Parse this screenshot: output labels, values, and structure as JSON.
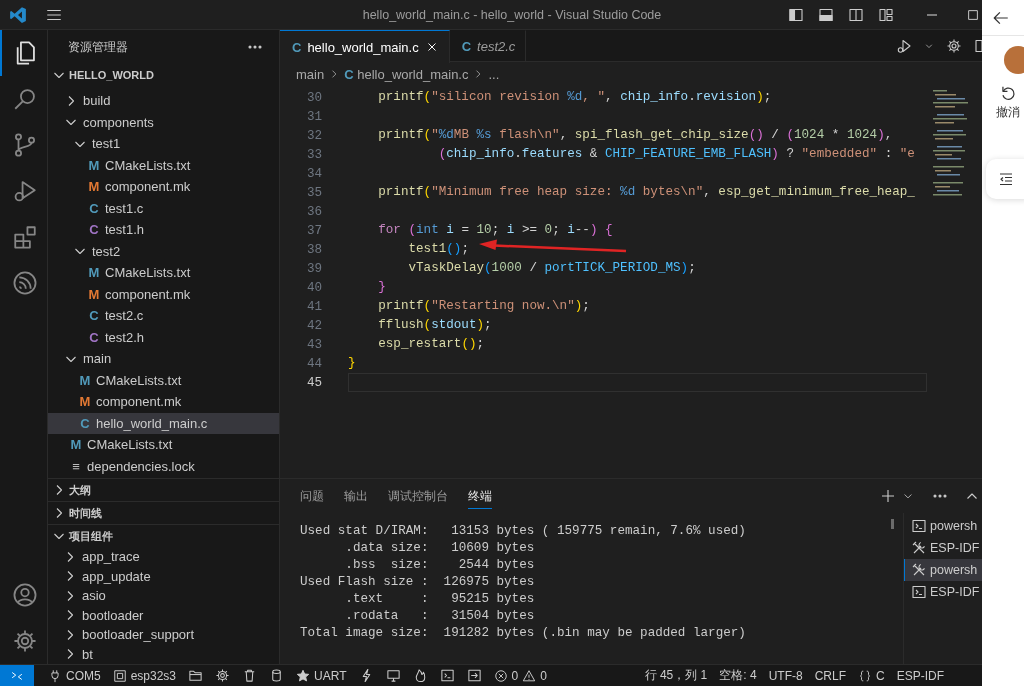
{
  "window": {
    "title": "hello_world_main.c - hello_world - Visual Studio Code"
  },
  "activity_bar": [
    {
      "selected": true
    },
    {
      "selected": false
    },
    {
      "selected": false
    },
    {
      "selected": false
    },
    {
      "selected": false
    },
    {
      "selected": false
    }
  ],
  "sidebar": {
    "title": "资源管理器",
    "workspace": {
      "name": "HELLO_WORLD",
      "expanded": true,
      "tree": [
        {
          "name": "build",
          "kind": "folder",
          "expanded": false,
          "selected": false
        },
        {
          "name": "components",
          "kind": "folder",
          "expanded": true,
          "selected": false,
          "children": [
            {
              "name": "test1",
              "kind": "folder",
              "expanded": true,
              "selected": false,
              "children": [
                {
                  "name": "CMakeLists.txt",
                  "kind": "cmake",
                  "badge": "M",
                  "selected": false
                },
                {
                  "name": "component.mk",
                  "kind": "make",
                  "badge": "M",
                  "selected": false
                },
                {
                  "name": "test1.c",
                  "kind": "c",
                  "badge": "C",
                  "selected": false
                },
                {
                  "name": "test1.h",
                  "kind": "h",
                  "badge": "C",
                  "selected": false
                }
              ]
            },
            {
              "name": "test2",
              "kind": "folder",
              "expanded": true,
              "selected": false,
              "children": [
                {
                  "name": "CMakeLists.txt",
                  "kind": "cmake",
                  "badge": "M",
                  "selected": false
                },
                {
                  "name": "component.mk",
                  "kind": "make",
                  "badge": "M",
                  "selected": false
                },
                {
                  "name": "test2.c",
                  "kind": "c",
                  "badge": "C",
                  "selected": false
                },
                {
                  "name": "test2.h",
                  "kind": "h",
                  "badge": "C",
                  "selected": false
                }
              ]
            }
          ]
        },
        {
          "name": "main",
          "kind": "folder",
          "expanded": true,
          "selected": false,
          "children": [
            {
              "name": "CMakeLists.txt",
              "kind": "cmake",
              "badge": "M",
              "selected": false
            },
            {
              "name": "component.mk",
              "kind": "make",
              "badge": "M",
              "selected": false
            },
            {
              "name": "hello_world_main.c",
              "kind": "c",
              "badge": "C",
              "selected": true
            }
          ]
        },
        {
          "name": "CMakeLists.txt",
          "kind": "cmake",
          "badge": "M",
          "selected": false
        },
        {
          "name": "dependencies.lock",
          "kind": "lock",
          "badge": "≡",
          "selected": false
        }
      ]
    },
    "sections": [
      {
        "title": "大纲",
        "expanded": false
      },
      {
        "title": "时间线",
        "expanded": false
      },
      {
        "title": "项目组件",
        "expanded": true,
        "items": [
          {
            "name": "app_trace",
            "expanded": false
          },
          {
            "name": "app_update",
            "expanded": false
          },
          {
            "name": "asio",
            "expanded": false
          },
          {
            "name": "bootloader",
            "expanded": false
          },
          {
            "name": "bootloader_support",
            "expanded": false
          },
          {
            "name": "bt",
            "expanded": false
          }
        ]
      }
    ]
  },
  "editor": {
    "tabs": [
      {
        "label": "hello_world_main.c",
        "badge": "C",
        "selected": true,
        "preview": false
      },
      {
        "label": "test2.c",
        "badge": "C",
        "selected": false,
        "preview": true
      }
    ],
    "breadcrumbs": [
      {
        "text": "main"
      },
      {
        "badge": "C",
        "text": "hello_world_main.c"
      },
      {
        "text": "..."
      }
    ],
    "lines": [
      {
        "number": "30",
        "current": false,
        "tokens": [
          {
            "kind": "fn",
            "text": "    printf"
          },
          {
            "kind": "b1",
            "text": "("
          },
          {
            "kind": "str",
            "text": "\"silicon revision "
          },
          {
            "kind": "fmt",
            "text": "%d"
          },
          {
            "kind": "str",
            "text": ", \""
          },
          {
            "kind": "p",
            "text": ", "
          },
          {
            "kind": "var",
            "text": "chip_info"
          },
          {
            "kind": "p",
            "text": "."
          },
          {
            "kind": "var",
            "text": "revision"
          },
          {
            "kind": "b1",
            "text": ")"
          },
          {
            "kind": "p",
            "text": ";"
          }
        ]
      },
      {
        "number": "31",
        "current": false
      },
      {
        "number": "32",
        "current": false,
        "tokens": [
          {
            "kind": "fn",
            "text": "    printf"
          },
          {
            "kind": "b1",
            "text": "("
          },
          {
            "kind": "str",
            "text": "\""
          },
          {
            "kind": "fmt",
            "text": "%d"
          },
          {
            "kind": "str",
            "text": "MB "
          },
          {
            "kind": "fmt",
            "text": "%s"
          },
          {
            "kind": "str",
            "text": " flash\\n\""
          },
          {
            "kind": "p",
            "text": ", "
          },
          {
            "kind": "fn",
            "text": "spi_flash_get_chip_size"
          },
          {
            "kind": "b2",
            "text": "()"
          },
          {
            "kind": "p",
            "text": " / "
          },
          {
            "kind": "b2",
            "text": "("
          },
          {
            "kind": "num",
            "text": "1024"
          },
          {
            "kind": "p",
            "text": " * "
          },
          {
            "kind": "num",
            "text": "1024"
          },
          {
            "kind": "b2",
            "text": ")"
          },
          {
            "kind": "p",
            "text": ","
          }
        ]
      },
      {
        "number": "33",
        "current": false,
        "tokens": [
          {
            "kind": "b2",
            "text": "            ("
          },
          {
            "kind": "var",
            "text": "chip_info"
          },
          {
            "kind": "p",
            "text": "."
          },
          {
            "kind": "var",
            "text": "features"
          },
          {
            "kind": "p",
            "text": " & "
          },
          {
            "kind": "mac",
            "text": "CHIP_FEATURE_EMB_FLASH"
          },
          {
            "kind": "b2",
            "text": ")"
          },
          {
            "kind": "p",
            "text": " ? "
          },
          {
            "kind": "str",
            "text": "\"embedded\""
          },
          {
            "kind": "p",
            "text": " : "
          },
          {
            "kind": "str",
            "text": "\"e"
          }
        ]
      },
      {
        "number": "34",
        "current": false
      },
      {
        "number": "35",
        "current": false,
        "tokens": [
          {
            "kind": "fn",
            "text": "    printf"
          },
          {
            "kind": "b1",
            "text": "("
          },
          {
            "kind": "str",
            "text": "\"Minimum free heap size: "
          },
          {
            "kind": "fmt",
            "text": "%d"
          },
          {
            "kind": "str",
            "text": " bytes\\n\""
          },
          {
            "kind": "p",
            "text": ", "
          },
          {
            "kind": "fn",
            "text": "esp_get_minimum_free_heap_"
          }
        ]
      },
      {
        "number": "36",
        "current": false
      },
      {
        "number": "37",
        "current": false,
        "tokens": [
          {
            "kind": "kw",
            "text": "    for "
          },
          {
            "kind": "b2",
            "text": "("
          },
          {
            "kind": "type",
            "text": "int "
          },
          {
            "kind": "var",
            "text": "i"
          },
          {
            "kind": "p",
            "text": " = "
          },
          {
            "kind": "num",
            "text": "10"
          },
          {
            "kind": "p",
            "text": "; "
          },
          {
            "kind": "var",
            "text": "i"
          },
          {
            "kind": "p",
            "text": " >= "
          },
          {
            "kind": "num",
            "text": "0"
          },
          {
            "kind": "p",
            "text": "; "
          },
          {
            "kind": "var",
            "text": "i"
          },
          {
            "kind": "p",
            "text": "--"
          },
          {
            "kind": "b2",
            "text": ") {"
          }
        ]
      },
      {
        "number": "38",
        "current": false,
        "tokens": [
          {
            "kind": "fn",
            "text": "        test1"
          },
          {
            "kind": "b3",
            "text": "()"
          },
          {
            "kind": "p",
            "text": ";"
          }
        ]
      },
      {
        "number": "39",
        "current": false,
        "tokens": [
          {
            "kind": "fn",
            "text": "        vTaskDelay"
          },
          {
            "kind": "b3",
            "text": "("
          },
          {
            "kind": "num",
            "text": "1000"
          },
          {
            "kind": "p",
            "text": " / "
          },
          {
            "kind": "mac",
            "text": "portTICK_PERIOD_MS"
          },
          {
            "kind": "b3",
            "text": ")"
          },
          {
            "kind": "p",
            "text": ";"
          }
        ]
      },
      {
        "number": "40",
        "current": false,
        "tokens": [
          {
            "kind": "b2",
            "text": "    }"
          }
        ]
      },
      {
        "number": "41",
        "current": false,
        "tokens": [
          {
            "kind": "fn",
            "text": "    printf"
          },
          {
            "kind": "b1",
            "text": "("
          },
          {
            "kind": "str",
            "text": "\"Restarting now.\\n\""
          },
          {
            "kind": "b1",
            "text": ")"
          },
          {
            "kind": "p",
            "text": ";"
          }
        ]
      },
      {
        "number": "42",
        "current": false,
        "tokens": [
          {
            "kind": "fn",
            "text": "    fflush"
          },
          {
            "kind": "b1",
            "text": "("
          },
          {
            "kind": "var",
            "text": "stdout"
          },
          {
            "kind": "b1",
            "text": ")"
          },
          {
            "kind": "p",
            "text": ";"
          }
        ]
      },
      {
        "number": "43",
        "current": false,
        "tokens": [
          {
            "kind": "fn",
            "text": "    esp_restart"
          },
          {
            "kind": "b1",
            "text": "()"
          },
          {
            "kind": "p",
            "text": ";"
          }
        ]
      },
      {
        "number": "44",
        "current": false,
        "tokens": [
          {
            "kind": "b1",
            "text": "}"
          }
        ]
      },
      {
        "number": "45",
        "current": true
      }
    ]
  },
  "panel": {
    "tabs": [
      {
        "label": "问题",
        "selected": false
      },
      {
        "label": "输出",
        "selected": false
      },
      {
        "label": "调试控制台",
        "selected": false
      },
      {
        "label": "终端",
        "selected": true
      }
    ],
    "terminal_lines": [
      "Used stat D/IRAM:   13153 bytes ( 159775 remain, 7.6% used)",
      "      .data size:   10609 bytes",
      "      .bss  size:    2544 bytes",
      "Used Flash size :  126975 bytes",
      "      .text     :   95215 bytes",
      "      .rodata   :   31504 bytes",
      "Total image size:  191282 bytes (.bin may be padded larger)"
    ],
    "terminals": [
      {
        "kind": "shell",
        "label": "powersh",
        "selected": false
      },
      {
        "kind": "tool",
        "label": "ESP-IDF",
        "selected": false
      },
      {
        "kind": "tool",
        "label": "powersh",
        "selected": true
      },
      {
        "kind": "shell",
        "label": "ESP-IDF",
        "selected": false
      }
    ]
  },
  "status_bar": {
    "port": "COM5",
    "target": "esp32s3",
    "monitor": "UART",
    "errors": "0",
    "warnings": "0",
    "position": "行 45，列 1",
    "indent": "空格: 4",
    "encoding": "UTF-8",
    "eol": "CRLF",
    "language": "C",
    "extension": "ESP-IDF"
  },
  "side_panel": {
    "undo_label": "撤消"
  }
}
